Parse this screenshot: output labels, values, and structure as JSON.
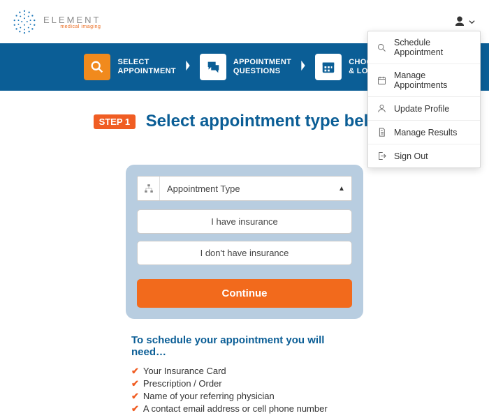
{
  "brand": {
    "name": "ELEMENT",
    "sub": "medical imaging"
  },
  "user_menu": {
    "items": [
      {
        "label": "Schedule Appointment",
        "icon": "search-icon"
      },
      {
        "label": "Manage Appointments",
        "icon": "calendar-icon"
      },
      {
        "label": "Update Profile",
        "icon": "user-icon"
      },
      {
        "label": "Manage Results",
        "icon": "document-icon"
      },
      {
        "label": "Sign Out",
        "icon": "signout-icon"
      }
    ]
  },
  "wizard": {
    "steps": [
      {
        "line1": "SELECT",
        "line2": "APPOINTMENT"
      },
      {
        "line1": "APPOINTMENT",
        "line2": "QUESTIONS"
      },
      {
        "line1": "CHOOSE TIME",
        "line2": "& LOCATION"
      }
    ]
  },
  "headline": {
    "badge": "STEP 1",
    "text": "Select appointment type below."
  },
  "form": {
    "type_placeholder": "Appointment Type",
    "options": [
      "I have insurance",
      "I don't have insurance"
    ],
    "continue_label": "Continue"
  },
  "requirements": {
    "title": "To schedule your appointment you will need…",
    "items": [
      "Your Insurance Card",
      "Prescription / Order",
      "Name of your referring physician",
      "A contact email address or cell phone number"
    ]
  }
}
